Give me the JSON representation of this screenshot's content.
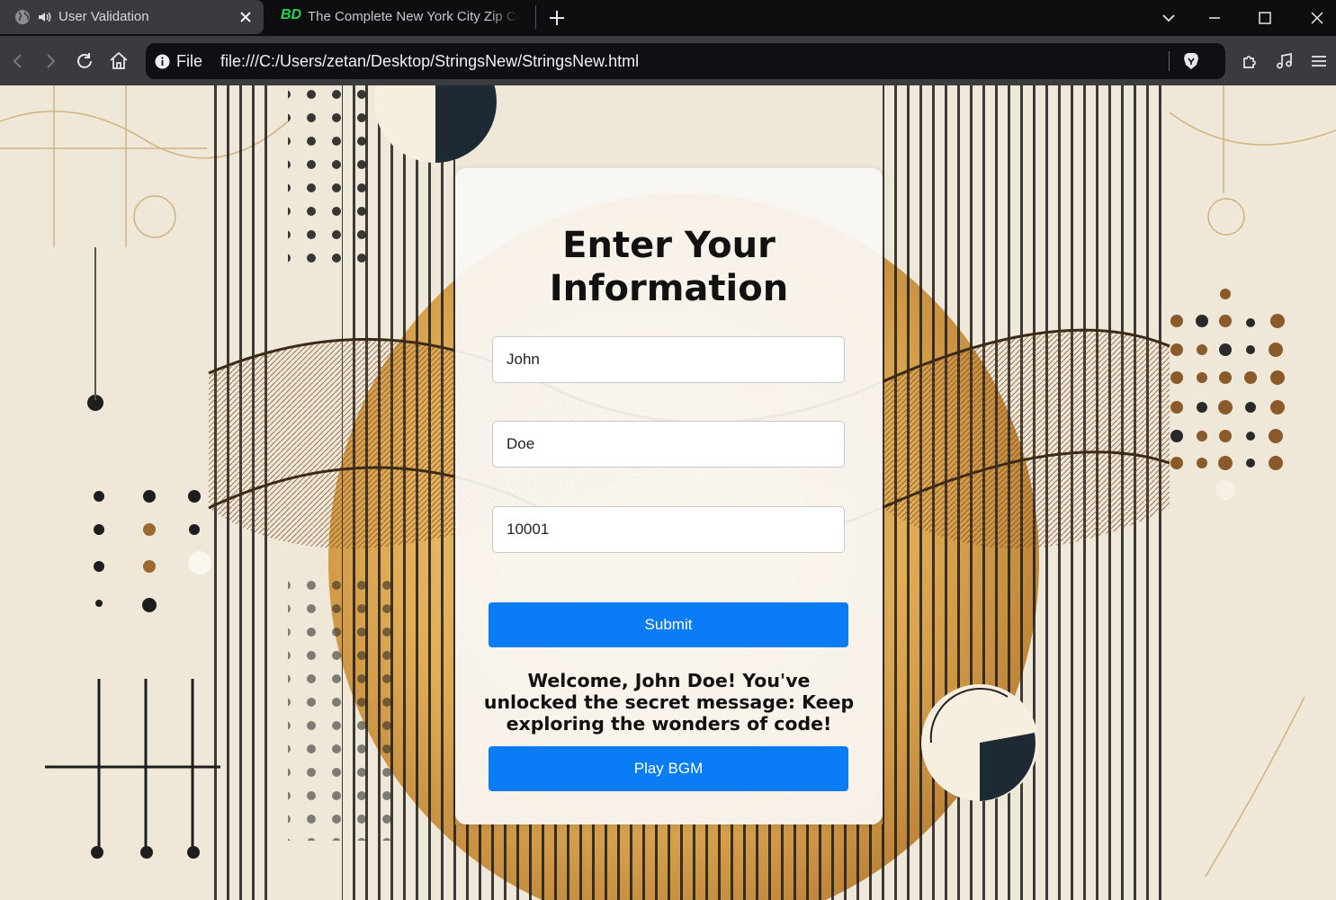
{
  "browser": {
    "tabs": [
      {
        "title": "User Validation",
        "active": true
      },
      {
        "title": "The Complete New York City Zip Codes List",
        "favicon_text": "BD",
        "active": false
      }
    ],
    "url_scheme_label": "File",
    "url": "file:///C:/Users/zetan/Desktop/StringsNew/StringsNew.html",
    "icons": [
      "globe-icon",
      "speaker-icon",
      "close-icon",
      "new-tab-icon",
      "chevron-down-icon",
      "minimize-icon",
      "maximize-icon",
      "window-close-icon",
      "back-icon",
      "forward-icon",
      "reload-icon",
      "home-icon",
      "info-icon",
      "brave-shield-icon",
      "extensions-icon",
      "media-icon",
      "menu-icon"
    ]
  },
  "form": {
    "heading": "Enter Your Information",
    "first_name": "John",
    "last_name": "Doe",
    "zip_code": "10001",
    "submit_label": "Submit",
    "message": "Welcome, John Doe! You've unlocked the secret message: Keep exploring the wonders of code!",
    "bgm_label": "Play BGM"
  },
  "colors": {
    "accent": "#0a7cf5",
    "background": "#efe8d8",
    "gold": "#d9a94e"
  }
}
